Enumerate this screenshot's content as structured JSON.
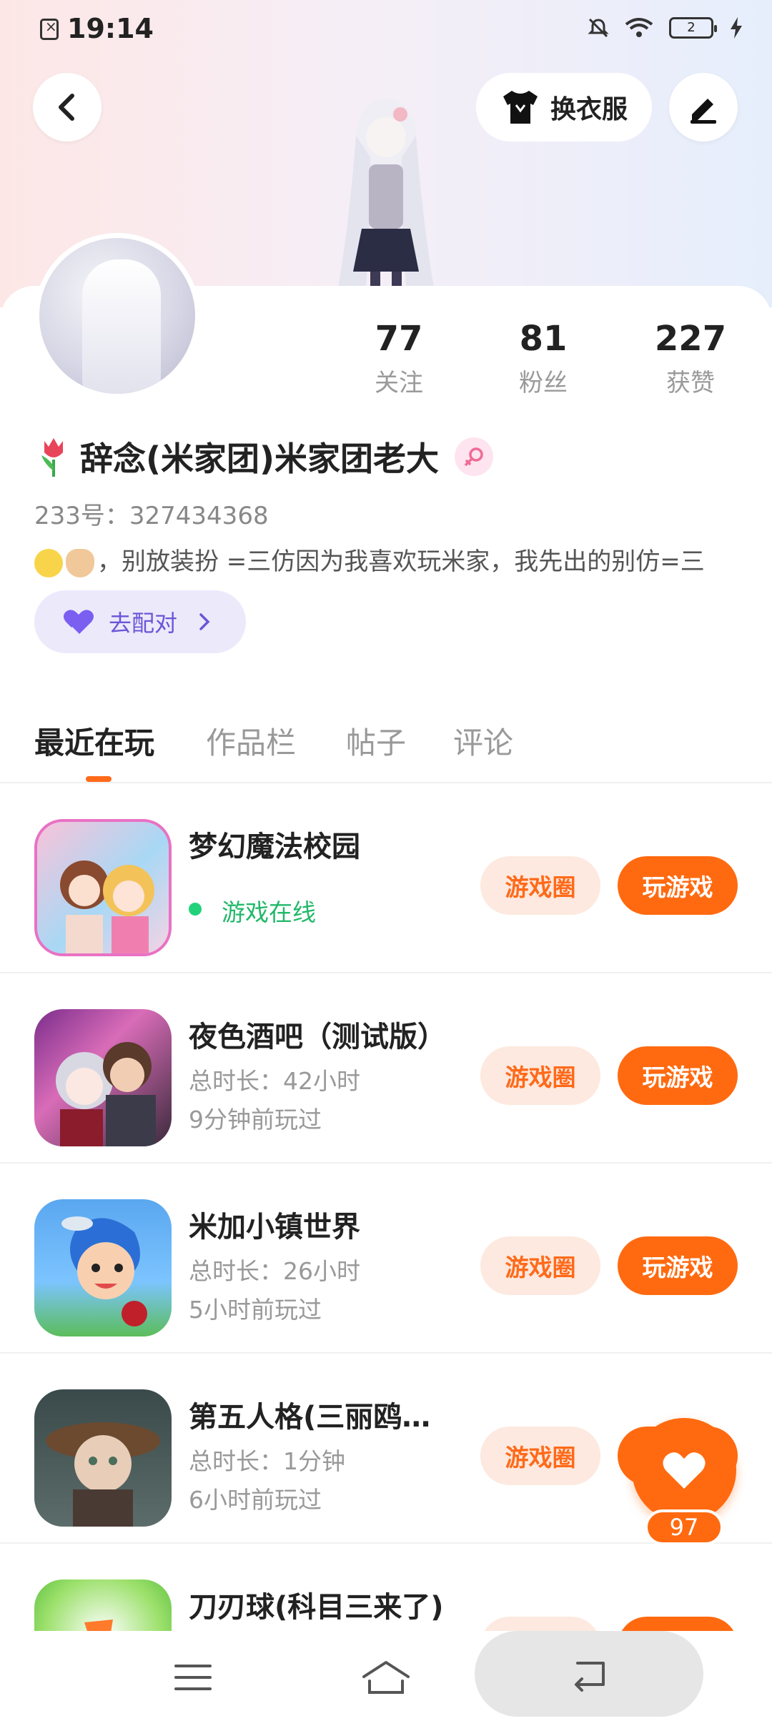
{
  "status_bar": {
    "time": "19:14",
    "battery_level": "2"
  },
  "header": {
    "change_outfit_label": "换衣服"
  },
  "stats": [
    {
      "value": "77",
      "label": "关注"
    },
    {
      "value": "81",
      "label": "粉丝"
    },
    {
      "value": "227",
      "label": "获赞"
    }
  ],
  "profile": {
    "name": "辞念(米家团)米家团老大",
    "uid": "233号：327434368",
    "bio": "，别放装扮 =三仿因为我喜欢玩米家，我先出的别仿=三",
    "match_label": "去配对"
  },
  "tabs": [
    {
      "label": "最近在玩",
      "active": true
    },
    {
      "label": "作品栏",
      "active": false
    },
    {
      "label": "帖子",
      "active": false
    },
    {
      "label": "评论",
      "active": false
    }
  ],
  "games": [
    {
      "title": "梦幻魔法校园",
      "line1": "游戏在线",
      "line2": "",
      "online": true
    },
    {
      "title": "夜色酒吧（测试版）",
      "line1": "总时长：42小时",
      "line2": "9分钟前玩过",
      "online": false
    },
    {
      "title": "米加小镇世界",
      "line1": "总时长：26小时",
      "line2": "5小时前玩过",
      "online": false
    },
    {
      "title": "第五人格(三丽鸥…",
      "line1": "总时长：1分钟",
      "line2": "6小时前玩过",
      "online": false
    },
    {
      "title": "刀刃球(科目三来了)",
      "line1": "",
      "line2": "",
      "online": false
    }
  ],
  "buttons": {
    "circle_label": "游戏圈",
    "play_label": "玩游戏"
  },
  "like_fab": {
    "count": "97"
  },
  "colors": {
    "accent": "#ff6a10",
    "accent_soft": "#fde9df",
    "match_bg": "#ece9fb",
    "match_text": "#6b56d6",
    "online_green": "#22b86a"
  }
}
